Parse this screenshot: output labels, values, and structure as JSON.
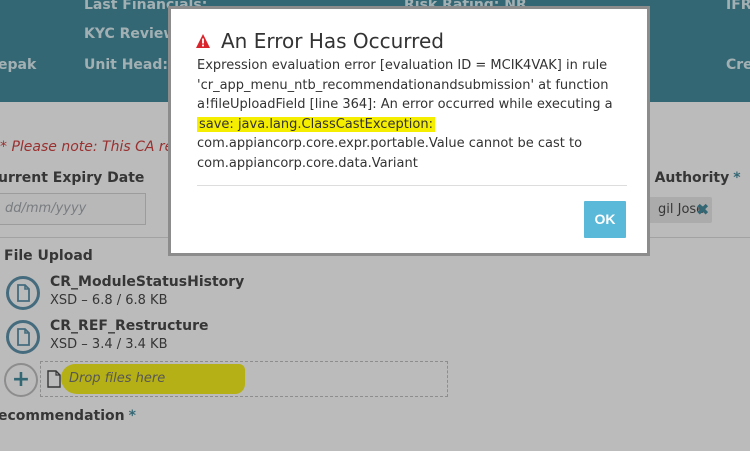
{
  "header": {
    "labels": [
      "Last Financials:",
      "KYC Review",
      "Unit Head:",
      "Risk Rating: NR",
      "IFR",
      "Cre"
    ],
    "left_fragment": "epak"
  },
  "form": {
    "note": "* Please note: This CA req",
    "expiry_label": "urrent Expiry Date",
    "expiry_placeholder": "dd/mm/yyyy",
    "authority_label": "xt Authority",
    "required_mark": "*",
    "authority_chip": "gil Jose",
    "authority_chip_remove": "✖",
    "file_upload_label": "File Upload",
    "files": [
      {
        "name": "CR_ModuleStatusHistory",
        "meta": "XSD – 6.8 / 6.8 KB"
      },
      {
        "name": "CR_REF_Restructure",
        "meta": "XSD – 3.4 / 3.4 KB"
      }
    ],
    "add_symbol": "+",
    "drop_text": "Drop files here",
    "recommendation_label": "ecommendation"
  },
  "modal": {
    "title": "An Error Has Occurred",
    "body_part1": "Expression evaluation error [evaluation ID = MCIK4VAK] in rule 'cr_app_menu_ntb_recommendationandsubmission' at function a!fileUploadField [line 364]: An error occurred while executing a",
    "body_highlight": "save: java.lang.ClassCastException:",
    "body_part2": "com.appiancorp.core.expr.portable.Value cannot be cast to com.appiancorp.core.data.Variant",
    "ok_label": "OK"
  },
  "colors": {
    "header_bg": "#2f7e93",
    "highlight": "#f6ee00",
    "ok_button": "#5ab8d8",
    "warning_icon": "#d9242b",
    "note_text": "#cc2a2a"
  }
}
